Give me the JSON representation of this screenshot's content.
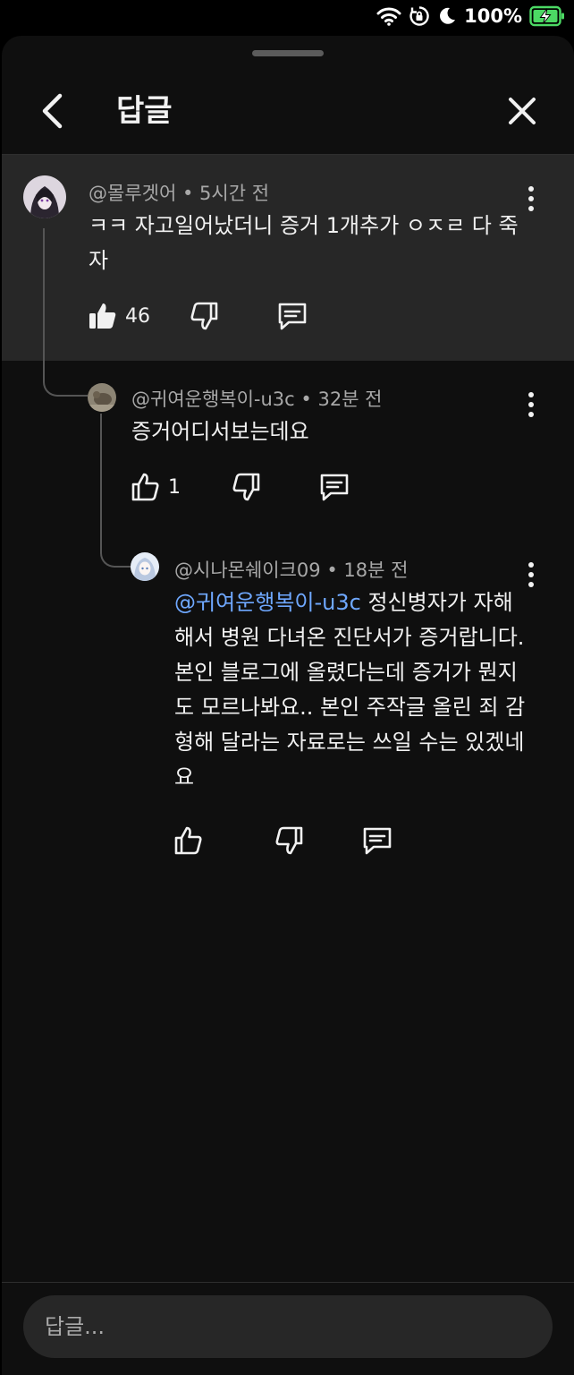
{
  "status_bar": {
    "battery_text": "100%",
    "icons": [
      "wifi-icon",
      "rotation-lock-icon",
      "moon-icon",
      "battery-charging-icon"
    ]
  },
  "header": {
    "title": "답글",
    "back_icon": "chevron-left-icon",
    "close_icon": "close-icon"
  },
  "comments": [
    {
      "author": "@몰루겟어",
      "time": "5시간 전",
      "text": "ㅋㅋ 자고일어났더니 증거 1개추가 ㅇㅈㄹ 다 죽자",
      "likes": "46"
    },
    {
      "author": "@귀여운행복이-u3c",
      "time": "32분 전",
      "text": "증거어디서보는데요",
      "likes": "1"
    },
    {
      "author": "@시나몬쉐이크09",
      "time": "18분 전",
      "mention": "@귀여운행복이-u3c",
      "text": " 정신병자가 자해해서 병원 다녀온 진단서가 증거랍니다. 본인 블로그에 올렸다는데 증거가 뭔지도 모르나봐요.. 본인 주작글 올린 죄 감형해 달라는 자료로는 쓰일 수는 있겠네요",
      "likes": ""
    }
  ],
  "meta_separator": " • ",
  "reply_box": {
    "placeholder": "답글..."
  },
  "colors": {
    "background": "#0f0f0f",
    "highlight": "#272727",
    "mention": "#6fa8ff",
    "battery": "#4cd964"
  }
}
